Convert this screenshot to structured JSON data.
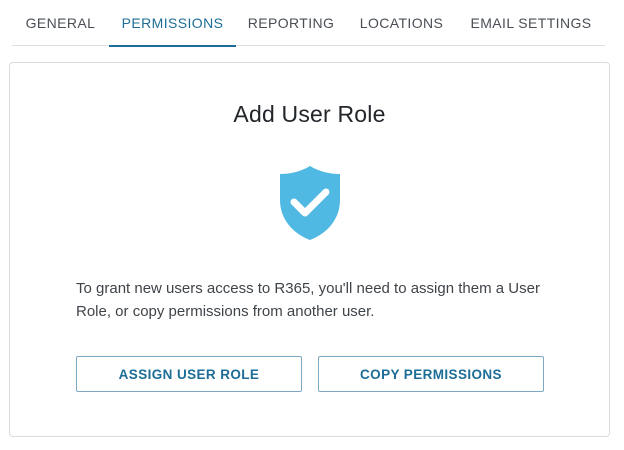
{
  "tabs": [
    {
      "label": "GENERAL",
      "active": false
    },
    {
      "label": "PERMISSIONS",
      "active": true
    },
    {
      "label": "REPORTING",
      "active": false
    },
    {
      "label": "LOCATIONS",
      "active": false
    },
    {
      "label": "EMAIL SETTINGS",
      "active": false
    }
  ],
  "card": {
    "title": "Add User Role",
    "icon": "shield-check-icon",
    "message": "To grant new users access to R365, you'll need to assign them a User Role, or copy permissions from another user.",
    "buttons": {
      "assign_label": "ASSIGN USER ROLE",
      "copy_label": "COPY PERMISSIONS"
    }
  },
  "colors": {
    "accent": "#1d6d97",
    "shield": "#4fb8e3",
    "text": "#3f4449",
    "border": "#d9dce0"
  }
}
